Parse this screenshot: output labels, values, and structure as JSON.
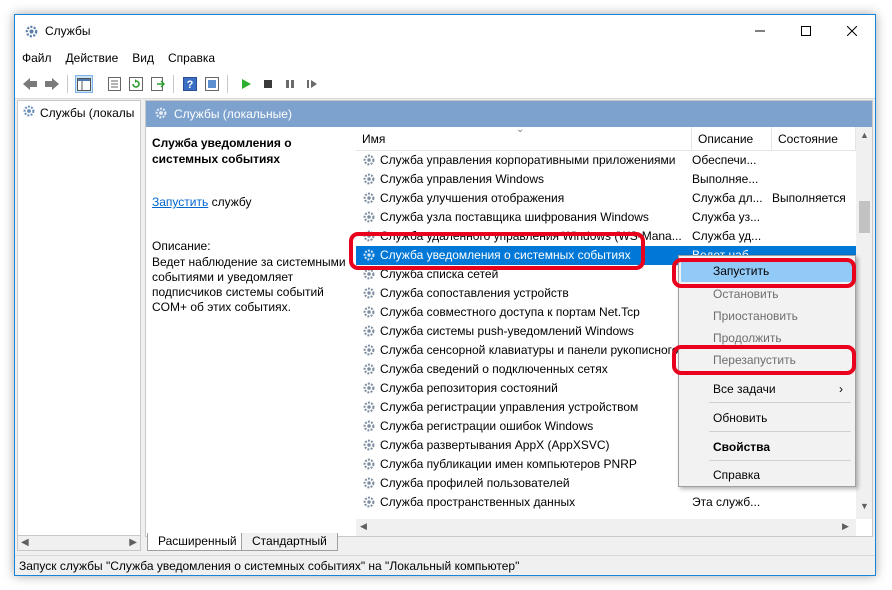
{
  "window": {
    "title": "Службы"
  },
  "menu": [
    "Файл",
    "Действие",
    "Вид",
    "Справка"
  ],
  "tree": {
    "root": "Службы (локалы"
  },
  "pane": {
    "header": "Службы (локальные)",
    "desc_title": "Служба уведомления о системных событиях",
    "action_link": "Запустить",
    "action_rest": " службу",
    "desc_label": "Описание:",
    "desc_text": "Ведет наблюдение за системными событиями и уведомляет подписчиков системы событий COM+ об этих событиях."
  },
  "columns": {
    "name": "Имя",
    "desc": "Описание",
    "status": "Состояние"
  },
  "rows": [
    {
      "name": "Служба управления корпоративными приложениями",
      "desc": "Обеспечи...",
      "status": ""
    },
    {
      "name": "Служба управления Windows",
      "desc": "Выполняе...",
      "status": ""
    },
    {
      "name": "Служба улучшения отображения",
      "desc": "Служба дл...",
      "status": "Выполняется"
    },
    {
      "name": "Служба узла поставщика шифрования Windows",
      "desc": "Служба уз...",
      "status": ""
    },
    {
      "name": "Служба удаленного управления Windows (WS-Mana...",
      "desc": "Служба уд...",
      "status": ""
    },
    {
      "name": "Служба уведомления о системных событиях",
      "desc": "Ведет наб...",
      "status": ""
    },
    {
      "name": "Служба списка сетей",
      "desc": "",
      "status": ""
    },
    {
      "name": "Служба сопоставления устройств",
      "desc": "",
      "status": ""
    },
    {
      "name": "Служба совместного доступа к портам Net.Tcp",
      "desc": "",
      "status": ""
    },
    {
      "name": "Служба системы push-уведомлений Windows",
      "desc": "",
      "status": ""
    },
    {
      "name": "Служба сенсорной клавиатуры и панели рукописного ввода",
      "desc": "",
      "status": ""
    },
    {
      "name": "Служба сведений о подключенных сетях",
      "desc": "",
      "status": ""
    },
    {
      "name": "Служба репозитория состояний",
      "desc": "",
      "status": ""
    },
    {
      "name": "Служба регистрации управления устройством",
      "desc": "",
      "status": ""
    },
    {
      "name": "Служба регистрации ошибок Windows",
      "desc": "",
      "status": ""
    },
    {
      "name": "Служба развертывания AppX (AppXSVC)",
      "desc": "",
      "status": ""
    },
    {
      "name": "Служба публикации имен компьютеров PNRP",
      "desc": "",
      "status": ""
    },
    {
      "name": "Служба профилей пользователей",
      "desc": "",
      "status": ""
    },
    {
      "name": "Служба пространственных данных",
      "desc": "Эта служб...",
      "status": ""
    }
  ],
  "context_menu": {
    "start": "Запустить",
    "stop": "Остановить",
    "pause": "Приостановить",
    "resume": "Продолжить",
    "restart": "Перезапустить",
    "all_tasks": "Все задачи",
    "refresh": "Обновить",
    "properties": "Свойства",
    "help": "Справка"
  },
  "tabs": {
    "extended": "Расширенный",
    "standard": "Стандартный"
  },
  "statusbar": "Запуск службы \"Служба уведомления о системных событиях\" на \"Локальный компьютер\"",
  "colors": {
    "accent": "#0078d7",
    "header": "#7da2ce",
    "highlight": "#e8001c",
    "menu_hover": "#91c9f7"
  },
  "icons": [
    "gear-icon",
    "back-icon",
    "forward-icon",
    "console-tree-icon",
    "properties-icon",
    "refresh-icon",
    "export-icon",
    "help-icon",
    "view-icon",
    "play-icon",
    "stop-icon",
    "pause-icon",
    "restart-icon"
  ]
}
